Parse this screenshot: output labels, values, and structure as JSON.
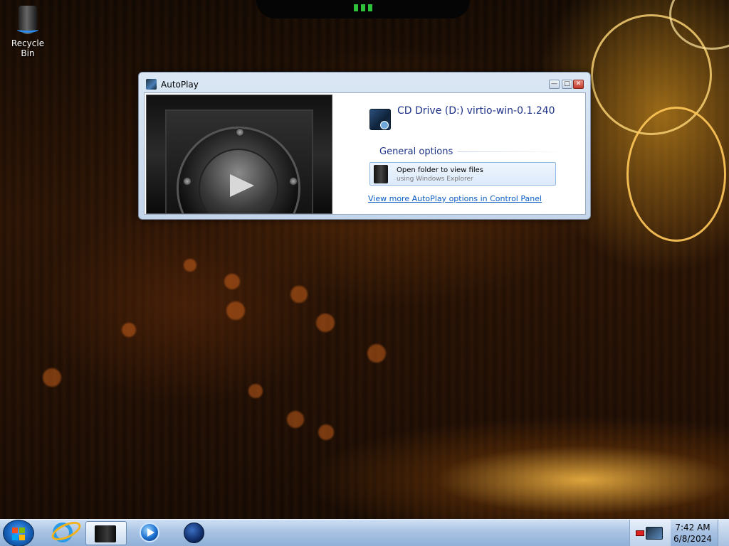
{
  "desktop": {
    "icons": [
      {
        "label": "Recycle Bin",
        "icon": "recycle-bin-icon"
      }
    ]
  },
  "autoplay": {
    "window_title": "AutoPlay",
    "device_title": "CD Drive (D:) virtio-win-0.1.240",
    "section_label": "General options",
    "option": {
      "main": "Open folder to view files",
      "sub": "using Windows Explorer"
    },
    "control_panel_link": "View more AutoPlay options in Control Panel",
    "controls": {
      "minimize": "—",
      "maximize": "□",
      "close": "✕"
    }
  },
  "taskbar": {
    "items": [
      "start-orb",
      "internet-explorer",
      "autoplay-drive",
      "windows-media-player",
      "network-globe"
    ],
    "clock": {
      "time": "7:42 AM",
      "date": "6/8/2024"
    }
  },
  "colors": {
    "link": "#0b5cc5",
    "heading": "#1e3287",
    "taskbar": "#a9c3e3"
  }
}
